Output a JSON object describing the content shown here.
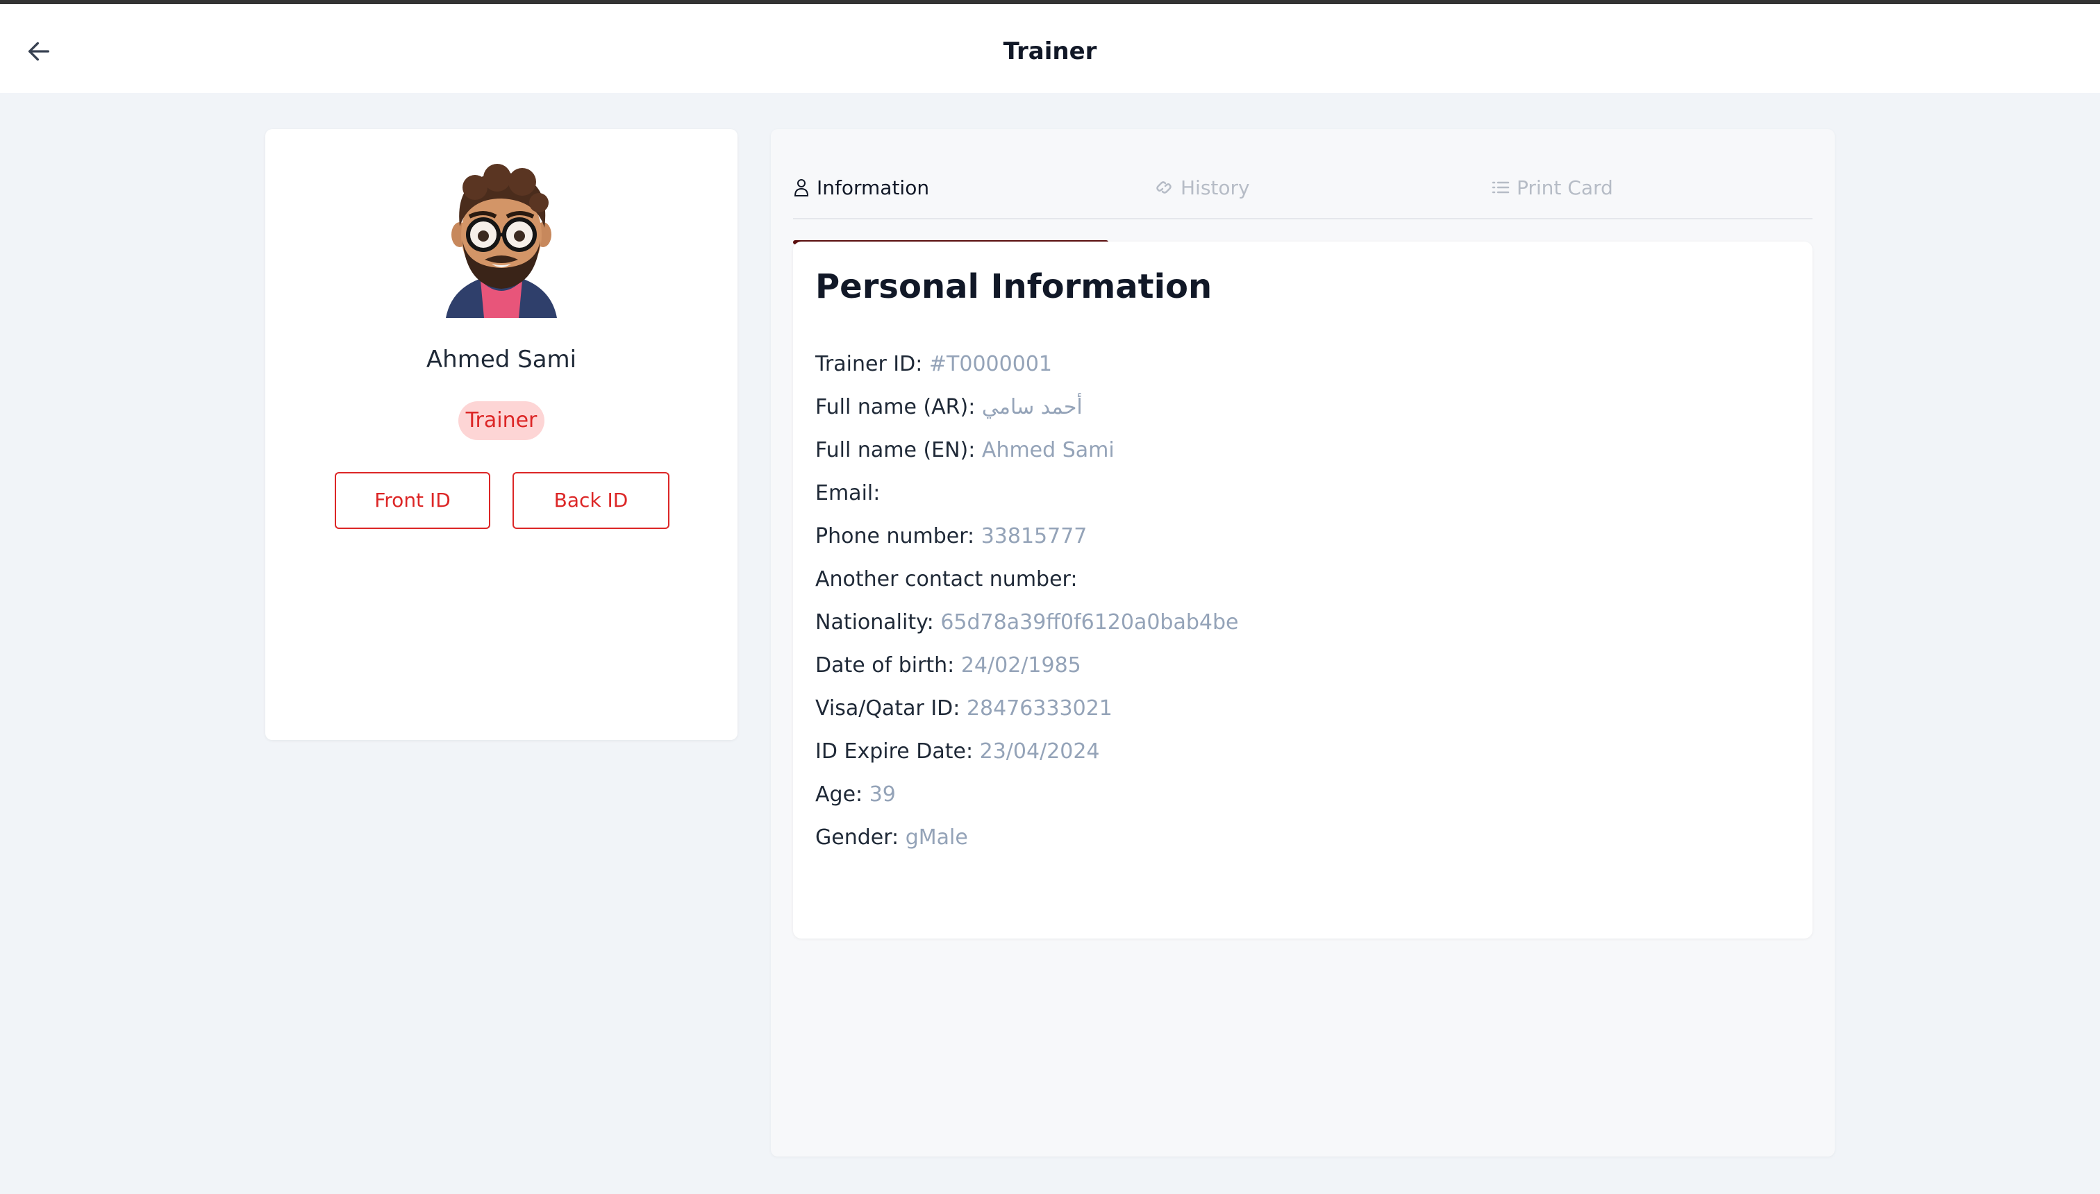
{
  "header": {
    "title": "Trainer",
    "back_icon": "arrow-left-icon"
  },
  "profile": {
    "name": "Ahmed Sami",
    "role": "Trainer",
    "front_id_label": "Front ID",
    "back_id_label": "Back ID",
    "avatar_icon": "avatar-icon"
  },
  "tabs": [
    {
      "label": "Information",
      "icon": "user-icon",
      "active": true
    },
    {
      "label": "History",
      "icon": "link-icon",
      "active": false
    },
    {
      "label": "Print Card",
      "icon": "list-icon",
      "active": false
    }
  ],
  "personal_info": {
    "title": "Personal Information",
    "fields": [
      {
        "label": "Trainer ID:",
        "value": "#T0000001"
      },
      {
        "label": "Full name (AR):",
        "value": "أحمد سامي"
      },
      {
        "label": "Full name (EN):",
        "value": "Ahmed Sami"
      },
      {
        "label": "Email:",
        "value": ""
      },
      {
        "label": "Phone number:",
        "value": "33815777"
      },
      {
        "label": "Another contact number:",
        "value": ""
      },
      {
        "label": "Nationality:",
        "value": "65d78a39ff0f6120a0bab4be"
      },
      {
        "label": "Date of birth:",
        "value": "24/02/1985"
      },
      {
        "label": "Visa/Qatar ID:",
        "value": "28476333021"
      },
      {
        "label": "ID Expire Date:",
        "value": "23/04/2024"
      },
      {
        "label": "Age:",
        "value": "39"
      },
      {
        "label": "Gender:",
        "value": "gMale"
      }
    ]
  },
  "colors": {
    "accent_red": "#dc2626",
    "badge_bg": "#fdd5d5",
    "tab_underline": "#5b0f0f",
    "value_gray": "#94a3b8"
  }
}
